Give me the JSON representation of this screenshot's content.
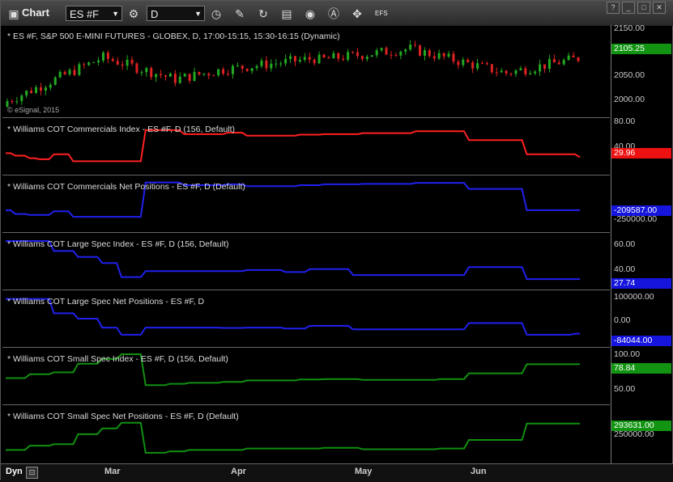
{
  "toolbar": {
    "chart_label": "Chart",
    "symbol": "ES #F",
    "interval": "D",
    "efs_label": "EFS",
    "icons": [
      "chart-icon",
      "settings-gear-icon",
      "interval-clock-icon",
      "draw-pencil-icon",
      "refresh-icon",
      "tools-icon",
      "alert-icon",
      "chart-properties-icon"
    ]
  },
  "window_buttons": [
    "?",
    "_",
    "□",
    "✕"
  ],
  "chart_data": [
    {
      "type": "candlestick",
      "pane": "price",
      "title": "* ES #F, S&P 500 E-MINI FUTURES - GLOBEX, D, 17:00-15:15, 15:30-16:15 (Dynamic)",
      "watermark": "© eSignal, 2015",
      "yticks": [
        "2150.00",
        "2100.00",
        "2050.00",
        "2000.00"
      ],
      "ylim": [
        1990,
        2160
      ],
      "last_value": "2105.25",
      "up_color": "#22aa22",
      "down_color": "#dd2222"
    },
    {
      "type": "line",
      "pane": "comm_index",
      "title": "* Williams COT Commercials Index - ES #F, D (156, Default)",
      "color": "#ff2020",
      "yticks": [
        "80.00",
        "40.00"
      ],
      "ylim": [
        0,
        100
      ],
      "last_value": "29.96",
      "values": [
        38,
        38,
        33,
        33,
        33,
        28,
        28,
        26,
        26,
        26,
        36,
        36,
        36,
        36,
        22,
        22,
        22,
        22,
        22,
        22,
        22,
        22,
        22,
        22,
        22,
        22,
        22,
        22,
        22,
        84,
        84,
        84,
        84,
        84,
        84,
        84,
        84,
        76,
        76,
        76,
        76,
        76,
        76,
        76,
        76,
        76,
        79,
        79,
        79,
        79,
        73,
        73,
        73,
        73,
        73,
        73,
        73,
        73,
        73,
        73,
        73,
        75,
        75,
        75,
        75,
        75,
        76,
        76,
        76,
        76,
        76,
        76,
        76,
        76,
        78,
        78,
        78,
        78,
        78,
        78,
        78,
        78,
        78,
        78,
        78,
        82,
        82,
        82,
        82,
        82,
        82,
        82,
        82,
        82,
        82,
        82,
        64,
        64,
        64,
        64,
        64,
        64,
        64,
        64,
        64,
        64,
        64,
        64,
        36,
        36,
        36,
        36,
        36,
        36,
        36,
        36,
        36,
        36,
        36,
        30
      ]
    },
    {
      "type": "line",
      "pane": "comm_net",
      "title": "* Williams COT Commercials Net Positions - ES #F, D (Default)",
      "color": "#2020ee",
      "yticks": [
        "-250000.00"
      ],
      "ylim": [
        -310000,
        -40000
      ],
      "last_value": "-209587.00",
      "values": [
        -210000,
        -210000,
        -230000,
        -230000,
        -230000,
        -235000,
        -235000,
        -235000,
        -235000,
        -235000,
        -215000,
        -215000,
        -215000,
        -215000,
        -245000,
        -245000,
        -245000,
        -245000,
        -245000,
        -245000,
        -245000,
        -245000,
        -245000,
        -245000,
        -245000,
        -245000,
        -245000,
        -245000,
        -245000,
        -60000,
        -60000,
        -60000,
        -60000,
        -60000,
        -60000,
        -60000,
        -60000,
        -75000,
        -75000,
        -75000,
        -75000,
        -75000,
        -75000,
        -75000,
        -75000,
        -75000,
        -70000,
        -70000,
        -70000,
        -70000,
        -80000,
        -80000,
        -80000,
        -80000,
        -80000,
        -80000,
        -80000,
        -80000,
        -80000,
        -80000,
        -80000,
        -75000,
        -75000,
        -75000,
        -75000,
        -75000,
        -70000,
        -70000,
        -70000,
        -70000,
        -70000,
        -70000,
        -70000,
        -70000,
        -68000,
        -68000,
        -68000,
        -68000,
        -68000,
        -68000,
        -68000,
        -68000,
        -68000,
        -68000,
        -68000,
        -62000,
        -62000,
        -62000,
        -62000,
        -62000,
        -62000,
        -62000,
        -62000,
        -62000,
        -62000,
        -62000,
        -95000,
        -95000,
        -95000,
        -95000,
        -95000,
        -95000,
        -95000,
        -95000,
        -95000,
        -95000,
        -95000,
        -95000,
        -209587,
        -209587,
        -209587,
        -209587,
        -209587,
        -209587,
        -209587,
        -209587,
        -209587,
        -209587,
        -209587,
        -209587
      ]
    },
    {
      "type": "line",
      "pane": "large_index",
      "title": "* Williams COT Large Spec Index - ES #F, D (156, Default)",
      "color": "#2020ee",
      "yticks": [
        "60.00",
        "40.00"
      ],
      "ylim": [
        20,
        70
      ],
      "last_value": "27.74",
      "values": [
        66,
        66,
        66,
        66,
        66,
        66,
        66,
        66,
        66,
        66,
        56,
        56,
        56,
        56,
        56,
        50,
        50,
        50,
        50,
        50,
        44,
        44,
        44,
        44,
        30,
        30,
        30,
        30,
        30,
        36,
        36,
        36,
        36,
        36,
        36,
        36,
        36,
        36,
        36,
        36,
        36,
        36,
        36,
        36,
        36,
        36,
        36,
        36,
        36,
        36,
        37,
        37,
        37,
        37,
        37,
        37,
        37,
        37,
        35,
        35,
        35,
        35,
        35,
        38,
        38,
        38,
        38,
        38,
        38,
        38,
        38,
        38,
        32,
        32,
        32,
        32,
        32,
        32,
        32,
        32,
        32,
        32,
        32,
        32,
        32,
        32,
        32,
        32,
        32,
        32,
        32,
        32,
        32,
        32,
        32,
        32,
        40,
        40,
        40,
        40,
        40,
        40,
        40,
        40,
        40,
        40,
        40,
        40,
        28,
        28,
        28,
        28,
        28,
        28,
        28,
        28,
        28,
        28,
        28,
        28
      ]
    },
    {
      "type": "line",
      "pane": "large_net",
      "title": "* Williams COT Large Spec Net Positions - ES #F, D",
      "color": "#2020ee",
      "yticks": [
        "100000.00",
        "0.00"
      ],
      "ylim": [
        -140000,
        140000
      ],
      "last_value": "-84044.00",
      "values": [
        110000,
        110000,
        110000,
        110000,
        110000,
        110000,
        110000,
        110000,
        110000,
        110000,
        30000,
        30000,
        30000,
        30000,
        30000,
        0,
        0,
        0,
        0,
        0,
        -50000,
        -50000,
        -50000,
        -50000,
        -90000,
        -90000,
        -90000,
        -90000,
        -90000,
        -50000,
        -50000,
        -50000,
        -50000,
        -50000,
        -50000,
        -50000,
        -50000,
        -50000,
        -50000,
        -50000,
        -50000,
        -50000,
        -50000,
        -50000,
        -50000,
        -52000,
        -52000,
        -52000,
        -52000,
        -52000,
        -50000,
        -50000,
        -50000,
        -50000,
        -50000,
        -50000,
        -50000,
        -50000,
        -55000,
        -55000,
        -55000,
        -55000,
        -55000,
        -40000,
        -40000,
        -40000,
        -40000,
        -40000,
        -40000,
        -40000,
        -40000,
        -40000,
        -60000,
        -60000,
        -60000,
        -60000,
        -60000,
        -60000,
        -60000,
        -60000,
        -60000,
        -60000,
        -60000,
        -60000,
        -60000,
        -60000,
        -60000,
        -60000,
        -60000,
        -60000,
        -60000,
        -60000,
        -60000,
        -60000,
        -60000,
        -60000,
        -25000,
        -25000,
        -25000,
        -25000,
        -25000,
        -25000,
        -25000,
        -25000,
        -25000,
        -25000,
        -25000,
        -25000,
        -90000,
        -90000,
        -90000,
        -90000,
        -90000,
        -90000,
        -90000,
        -90000,
        -90000,
        -90000,
        -84044,
        -84044
      ]
    },
    {
      "type": "line",
      "pane": "small_index",
      "title": "* Williams COT Small Spec Index - ES #F, D (156, Default)",
      "color": "#109010",
      "yticks": [
        "100.00",
        "50.00"
      ],
      "ylim": [
        0,
        105
      ],
      "last_value": "78.84",
      "values": [
        50,
        50,
        50,
        50,
        50,
        58,
        58,
        58,
        58,
        58,
        62,
        62,
        62,
        62,
        62,
        80,
        80,
        80,
        80,
        80,
        90,
        90,
        90,
        90,
        100,
        100,
        100,
        100,
        100,
        35,
        35,
        35,
        35,
        35,
        38,
        38,
        38,
        38,
        40,
        40,
        40,
        40,
        40,
        40,
        40,
        42,
        42,
        42,
        42,
        42,
        45,
        45,
        45,
        45,
        45,
        45,
        45,
        45,
        45,
        45,
        45,
        47,
        47,
        47,
        47,
        47,
        48,
        48,
        48,
        48,
        48,
        48,
        48,
        48,
        46,
        46,
        46,
        46,
        46,
        46,
        46,
        46,
        46,
        46,
        46,
        46,
        46,
        46,
        46,
        46,
        48,
        48,
        48,
        48,
        48,
        48,
        60,
        60,
        60,
        60,
        60,
        60,
        60,
        60,
        60,
        60,
        60,
        60,
        79,
        79,
        79,
        79,
        79,
        79,
        79,
        79,
        79,
        79,
        79,
        79
      ]
    },
    {
      "type": "line",
      "pane": "small_net",
      "title": "* Williams COT Small Spec Net Positions - ES #F, D (Default)",
      "color": "#109010",
      "yticks": [
        "250000.00"
      ],
      "ylim": [
        50000,
        400000
      ],
      "last_value": "293631.00",
      "values": [
        110000,
        110000,
        110000,
        110000,
        110000,
        140000,
        140000,
        140000,
        140000,
        140000,
        150000,
        150000,
        150000,
        150000,
        150000,
        220000,
        220000,
        220000,
        220000,
        220000,
        260000,
        260000,
        260000,
        260000,
        300000,
        300000,
        300000,
        300000,
        300000,
        90000,
        90000,
        90000,
        90000,
        90000,
        100000,
        100000,
        100000,
        100000,
        110000,
        110000,
        110000,
        110000,
        110000,
        110000,
        110000,
        110000,
        110000,
        110000,
        110000,
        110000,
        120000,
        120000,
        120000,
        120000,
        120000,
        120000,
        120000,
        120000,
        120000,
        120000,
        120000,
        120000,
        120000,
        120000,
        120000,
        120000,
        125000,
        125000,
        125000,
        125000,
        125000,
        125000,
        125000,
        125000,
        115000,
        115000,
        115000,
        115000,
        115000,
        115000,
        115000,
        115000,
        115000,
        115000,
        115000,
        115000,
        115000,
        115000,
        115000,
        115000,
        120000,
        120000,
        120000,
        120000,
        120000,
        120000,
        180000,
        180000,
        180000,
        180000,
        180000,
        180000,
        180000,
        180000,
        180000,
        180000,
        180000,
        180000,
        293631,
        293631,
        293631,
        293631,
        293631,
        293631,
        293631,
        293631,
        293631,
        293631,
        293631,
        293631
      ]
    }
  ],
  "xaxis": {
    "months": [
      "Mar",
      "Apr",
      "May",
      "Jun"
    ]
  },
  "status": {
    "mode": "Dyn"
  }
}
